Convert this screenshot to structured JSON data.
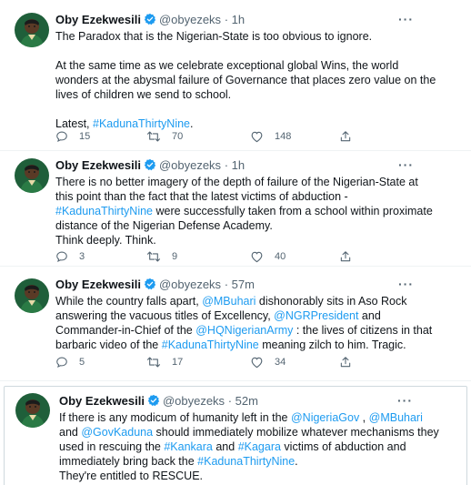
{
  "tweets": [
    {
      "name": "Oby Ezekwesili",
      "handle": "@obyezeks",
      "dot": "·",
      "time": "1h",
      "lines": [
        [
          {
            "t": "The Paradox that is the Nigerian-State is too obvious to ignore."
          }
        ],
        [],
        [
          {
            "t": "At the same time as we celebrate exceptional global Wins, the world"
          }
        ],
        [
          {
            "t": "wonders at the abysmal failure of Governance that places zero value on the"
          }
        ],
        [
          {
            "t": "lives of children we send to school."
          }
        ],
        [],
        [
          {
            "t": "Latest, "
          },
          {
            "t": "#KadunaThirtyNine",
            "link": true
          },
          {
            "t": "."
          }
        ]
      ],
      "replies": "15",
      "retweets": "70",
      "likes": "148"
    },
    {
      "name": "Oby Ezekwesili",
      "handle": "@obyezeks",
      "dot": "·",
      "time": "1h",
      "lines": [
        [
          {
            "t": "There is no better imagery of the depth of failure of the Nigerian-State at"
          }
        ],
        [
          {
            "t": "this point than the fact that the latest victims of abduction -"
          }
        ],
        [
          {
            "t": "#KadunaThirtyNine",
            "link": true
          },
          {
            "t": " were successfully taken from a school within proximate"
          }
        ],
        [
          {
            "t": "distance of the Nigerian Defense Academy."
          }
        ],
        [
          {
            "t": "Think deeply. Think."
          }
        ]
      ],
      "replies": "3",
      "retweets": "9",
      "likes": "40"
    },
    {
      "name": "Oby Ezekwesili",
      "handle": "@obyezeks",
      "dot": "·",
      "time": "57m",
      "lines": [
        [
          {
            "t": "While the country falls apart, "
          },
          {
            "t": "@MBuhari",
            "link": true
          },
          {
            "t": " dishonorably sits in Aso Rock"
          }
        ],
        [
          {
            "t": "answering the vacuous titles of Excellency, "
          },
          {
            "t": "@NGRPresident",
            "link": true
          },
          {
            "t": " and"
          }
        ],
        [
          {
            "t": "Commander-in-Chief of the "
          },
          {
            "t": "@HQNigerianArmy",
            "link": true
          },
          {
            "t": " : the lives of citizens in that"
          }
        ],
        [
          {
            "t": "barbaric video of the "
          },
          {
            "t": "#KadunaThirtyNine",
            "link": true
          },
          {
            "t": " meaning zilch to him. Tragic."
          }
        ]
      ],
      "replies": "5",
      "retweets": "17",
      "likes": "34"
    },
    {
      "name": "Oby Ezekwesili",
      "handle": "@obyezeks",
      "dot": "·",
      "time": "52m",
      "lines": [
        [
          {
            "t": "If there is any modicum of humanity left in the "
          },
          {
            "t": "@NigeriaGov",
            "link": true
          },
          {
            "t": " , "
          },
          {
            "t": "@MBuhari",
            "link": true
          }
        ],
        [
          {
            "t": "and "
          },
          {
            "t": "@GovKaduna",
            "link": true
          },
          {
            "t": "  should immediately mobilize whatever mechanisms they"
          }
        ],
        [
          {
            "t": "used in rescuing the "
          },
          {
            "t": "#Kankara",
            "link": true
          },
          {
            "t": " and "
          },
          {
            "t": "#Kagara",
            "link": true
          },
          {
            "t": " victims of abduction and"
          }
        ],
        [
          {
            "t": "immediately bring back the "
          },
          {
            "t": "#KadunaThirtyNine",
            "link": true
          },
          {
            "t": "."
          }
        ],
        [
          {
            "t": "They're entitled to RESCUE."
          }
        ]
      ]
    }
  ],
  "icons": {
    "reply": "reply-icon",
    "retweet": "retweet-icon",
    "like": "like-icon",
    "share": "share-icon",
    "verified": "verified-badge-icon",
    "more": "more-options-icon"
  },
  "colors": {
    "link": "#1d9bf0",
    "secondary_text": "#536471",
    "verified": "#1d9bf0"
  }
}
